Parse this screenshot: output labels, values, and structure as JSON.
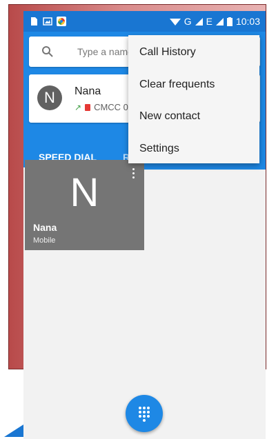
{
  "status_bar": {
    "network": "G",
    "network2": "E",
    "time": "10:03"
  },
  "search": {
    "placeholder": "Type a name"
  },
  "recent_contact": {
    "avatar_letter": "N",
    "name": "Nana",
    "detail": "CMCC 0"
  },
  "tabs": [
    {
      "label": "SPEED DIAL"
    },
    {
      "label": "RECENTS"
    }
  ],
  "speed_dial": [
    {
      "letter": "N",
      "name": "Nana",
      "type": "Mobile"
    }
  ],
  "overflow_menu": {
    "items": [
      {
        "label": "Call History"
      },
      {
        "label": "Clear frequents"
      },
      {
        "label": "New contact"
      },
      {
        "label": "Settings"
      }
    ]
  },
  "colors": {
    "primary": "#1e88e5",
    "status_bar": "#1976d2",
    "tile": "#757575"
  },
  "icons": {
    "fab": "dialpad-icon",
    "search": "search-icon"
  }
}
